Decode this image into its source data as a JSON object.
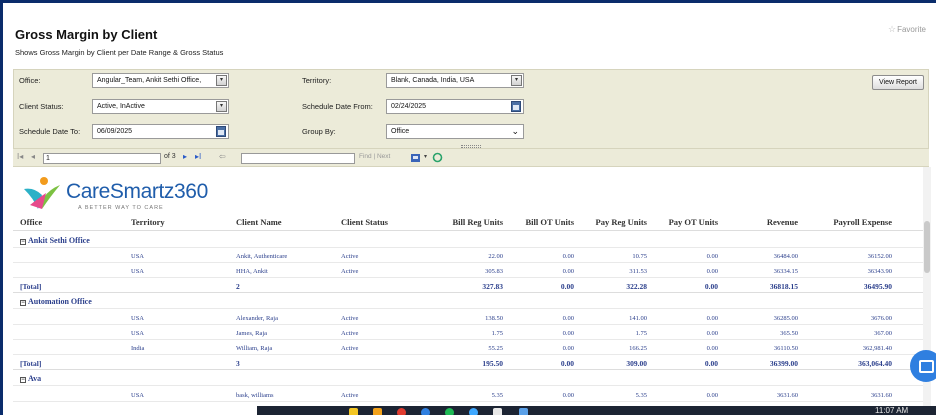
{
  "page": {
    "title": "Gross Margin by Client",
    "subtitle": "Shows Gross Margin by Client per Date Range & Gross Status",
    "favorite_label": "Favorite"
  },
  "params": {
    "office": {
      "label": "Office:",
      "value": "Angular_Team, Ankit Sethi Office,"
    },
    "territory": {
      "label": "Territory:",
      "value": "Blank, Canada, India, USA"
    },
    "client_status": {
      "label": "Client Status:",
      "value": "Active, InActive"
    },
    "schedule_date_from": {
      "label": "Schedule Date From:",
      "value": "02/24/2025"
    },
    "schedule_date_to": {
      "label": "Schedule Date To:",
      "value": "06/09/2025"
    },
    "group_by": {
      "label": "Group By:",
      "value": "Office"
    },
    "view_report_label": "View Report"
  },
  "toolbar": {
    "first": "I◂",
    "prev": "◂",
    "page_value": "1",
    "of_pages": "of 3",
    "next": "▸",
    "last": "▸I",
    "back": "⇦",
    "find_next": "Find | Next"
  },
  "logo": {
    "name": "CareSmartz360",
    "tagline": "A BETTER WAY TO CARE"
  },
  "columns": [
    "Office",
    "Territory",
    "Client Name",
    "Client Status",
    "Bill Reg Units",
    "Bill OT Units",
    "Pay Reg Units",
    "Pay OT Units",
    "Revenue",
    "Payroll Expense"
  ],
  "groups": [
    {
      "name": "Ankit Sethi Office",
      "rows": [
        {
          "territory": "USA",
          "client": "Ankit, Authenticare",
          "status": "Active",
          "bill_reg": "22.00",
          "bill_ot": "0.00",
          "pay_reg": "10.75",
          "pay_ot": "0.00",
          "revenue": "36484.00",
          "payroll": "36152.00"
        },
        {
          "territory": "USA",
          "client": "HHA, Ankit",
          "status": "Active",
          "bill_reg": "305.83",
          "bill_ot": "0.00",
          "pay_reg": "311.53",
          "pay_ot": "0.00",
          "revenue": "36334.15",
          "payroll": "36343.90"
        }
      ],
      "total": {
        "label": "[Total]",
        "count": "2",
        "bill_reg": "327.83",
        "bill_ot": "0.00",
        "pay_reg": "322.28",
        "pay_ot": "0.00",
        "revenue": "36818.15",
        "payroll": "36495.90"
      }
    },
    {
      "name": "Automation Office",
      "rows": [
        {
          "territory": "USA",
          "client": "Alexander, Raja",
          "status": "Active",
          "bill_reg": "138.50",
          "bill_ot": "0.00",
          "pay_reg": "141.00",
          "pay_ot": "0.00",
          "revenue": "36285.00",
          "payroll": "3676.00"
        },
        {
          "territory": "USA",
          "client": "James, Raja",
          "status": "Active",
          "bill_reg": "1.75",
          "bill_ot": "0.00",
          "pay_reg": "1.75",
          "pay_ot": "0.00",
          "revenue": "365.50",
          "payroll": "367.00"
        },
        {
          "territory": "India",
          "client": "William, Raja",
          "status": "Active",
          "bill_reg": "55.25",
          "bill_ot": "0.00",
          "pay_reg": "166.25",
          "pay_ot": "0.00",
          "revenue": "36110.50",
          "payroll": "362,981.40"
        }
      ],
      "total": {
        "label": "[Total]",
        "count": "3",
        "bill_reg": "195.50",
        "bill_ot": "0.00",
        "pay_reg": "309.00",
        "pay_ot": "0.00",
        "revenue": "36399.00",
        "payroll": "363,064.40"
      }
    },
    {
      "name": "Ava",
      "rows": [
        {
          "territory": "USA",
          "client": "bask, williams",
          "status": "Active",
          "bill_reg": "5.35",
          "bill_ot": "0.00",
          "pay_reg": "5.35",
          "pay_ot": "0.00",
          "revenue": "3631.60",
          "payroll": "3631.60"
        }
      ]
    }
  ],
  "system": {
    "clock": "11:07 AM"
  },
  "colors": {
    "panel_bg": "#ecebd9",
    "link_blue": "#2b3f8c",
    "brand_blue": "#1f5dab",
    "frame_border": "#0a2c6b"
  }
}
